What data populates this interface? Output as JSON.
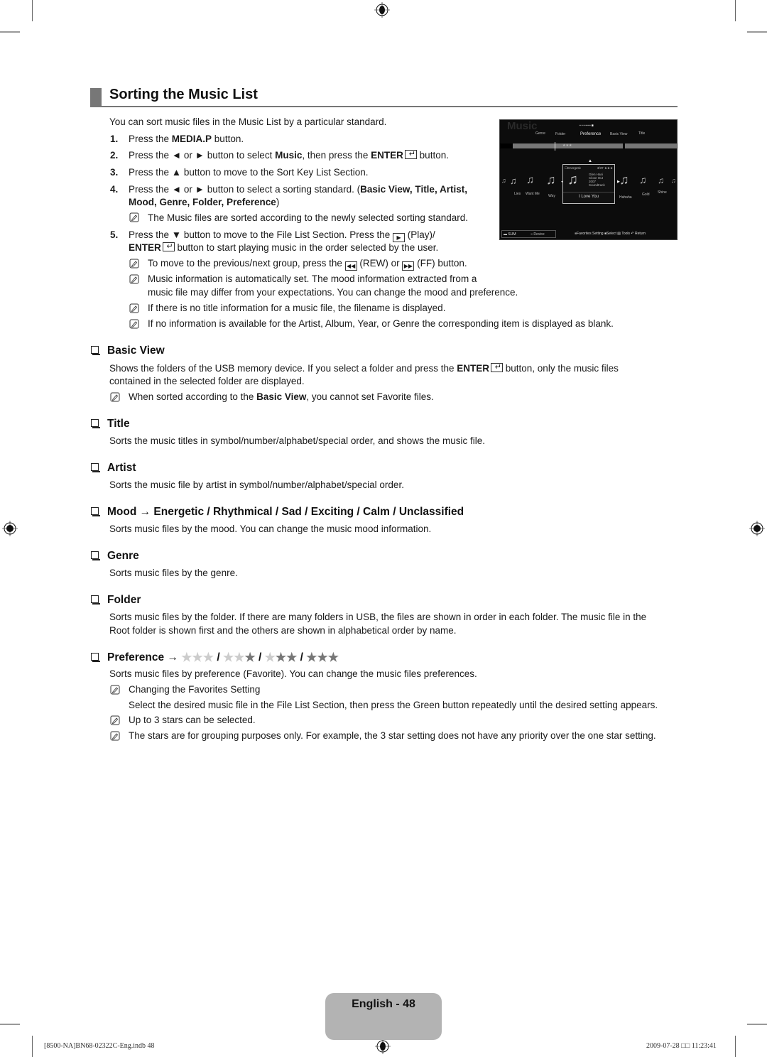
{
  "page": {
    "title": "Sorting the Music List",
    "intro": "You can sort music files in the Music List by a particular standard.",
    "steps": [
      {
        "num": "1.",
        "parts": [
          {
            "t": "Press the "
          },
          {
            "b": "MEDIA.P"
          },
          {
            "t": " button."
          }
        ]
      },
      {
        "num": "2.",
        "parts": [
          {
            "t": "Press the ◄ or ► button to select "
          },
          {
            "b": "Music"
          },
          {
            "t": ", then press the "
          },
          {
            "b": "ENTER"
          },
          {
            "enter": true
          },
          {
            "t": " button."
          }
        ]
      },
      {
        "num": "3.",
        "parts": [
          {
            "t": "Press the ▲ button to move to the Sort Key List Section."
          }
        ]
      },
      {
        "num": "4.",
        "line1": [
          {
            "t": "Press the ◄ or ► button to select a sorting standard. ("
          },
          {
            "b": "Basic View, Title, Artist,"
          }
        ],
        "line2": [
          {
            "b": "Mood, Genre, Folder, Preference"
          },
          {
            "t": ")"
          }
        ]
      },
      {
        "num": "5.",
        "line1": [
          {
            "t": "Press the ▼ button to move to the File List Section. Press the "
          },
          {
            "play": true
          },
          {
            "t": " (Play)/"
          }
        ],
        "line2": [
          {
            "b": "ENTER"
          },
          {
            "enter": true
          },
          {
            "t": " button to start playing music in the order selected by the user."
          }
        ]
      }
    ],
    "step4_note": "The Music files are sorted according to the newly selected sorting standard.",
    "step5_notes": {
      "n1_a": "To move to the previous/next group, press the ",
      "n1_b": " (REW) or ",
      "n1_c": " (FF) button.",
      "n2_line1": "Music information is automatically set. The mood information extracted from a",
      "n2_line2": "music file may differ from your expectations. You can change the mood and preference.",
      "n3": "If there is no title information for a music file, the filename is displayed.",
      "n4": "If no information is available for the Artist, Album, Year, or Genre the corresponding item is displayed as blank."
    },
    "sections": {
      "basic_view": {
        "heading": "Basic View",
        "body_a": "Shows the folders of the USB memory device. If you select a folder and press the ",
        "body_bold": "ENTER",
        "body_b": " button, only the music files",
        "body_line2": "contained in the selected folder are displayed.",
        "note_a": "When sorted according to the ",
        "note_bold": "Basic View",
        "note_b": ", you cannot set Favorite files."
      },
      "title": {
        "heading": "Title",
        "body": "Sorts the music titles in symbol/number/alphabet/special order, and shows the music file."
      },
      "artist": {
        "heading": "Artist",
        "body": "Sorts the music file by artist in symbol/number/alphabet/special order."
      },
      "mood": {
        "heading": "Mood → Energetic / Rhythmical / Sad / Exciting / Calm / Unclassified",
        "body": "Sorts music files by the mood. You can change the music mood information."
      },
      "genre": {
        "heading": "Genre",
        "body": "Sorts music files by the genre."
      },
      "folder": {
        "heading": "Folder",
        "body_line1": "Sorts music files by the folder. If there are many folders in USB, the files are shown in order in each folder. The music file in the",
        "body_line2": "Root folder is shown first and the others are shown in alphabetical order by name."
      },
      "preference": {
        "heading": "Preference →",
        "star_levels": [
          0,
          1,
          2,
          3
        ],
        "separator": "/",
        "body": "Sorts music files by preference (Favorite). You can change the music files preferences.",
        "note1": "Changing the Favorites Setting",
        "note1_detail": "Select the desired music file in the File List Section, then press the Green button repeatedly until the desired setting appears.",
        "note2": "Up to 3 stars can be selected.",
        "note3": "The stars are for grouping purposes only. For example, the 3 star setting does not have any priority over the one star setting."
      }
    },
    "tv": {
      "title": "Music",
      "sort_tabs": [
        "Genre",
        "Folder",
        "Preference",
        "Basic View",
        "Title"
      ],
      "active_tab": "Preference",
      "bar_label": "★★★",
      "tracks_left": [
        "Lies",
        "Want Me",
        "Way"
      ],
      "tracks_right": [
        "Hahaha",
        "Gold",
        "Shine"
      ],
      "focus": {
        "mood": "Energetic",
        "count": "3/37",
        "stars": "★★★",
        "artist": "Glen Hani",
        "album": "Close Out",
        "year": "2007",
        "genre": "Soundtrack",
        "title": "I Love You"
      },
      "device_label": "SUM",
      "device_btn": "Device",
      "hints": [
        "Favorites Setting",
        "Select",
        "Tools",
        "Return"
      ]
    },
    "footer": {
      "page_label": "English - 48",
      "slug_left": "[8500-NA]BN68-02322C-Eng.indb   48",
      "slug_right": "2009-07-28   □□ 11:23:41"
    }
  }
}
